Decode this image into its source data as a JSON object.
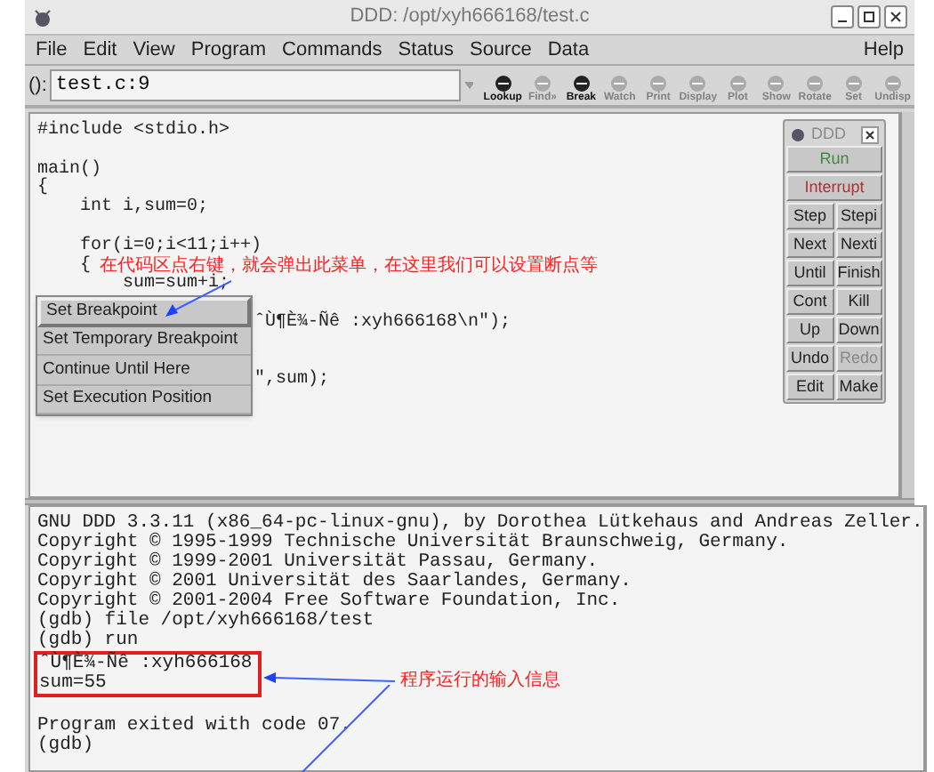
{
  "window": {
    "title": "DDD: /opt/xyh666168/test.c"
  },
  "menu": [
    {
      "label": "File"
    },
    {
      "label": "Edit"
    },
    {
      "label": "View"
    },
    {
      "label": "Program"
    },
    {
      "label": "Commands"
    },
    {
      "label": "Status"
    },
    {
      "label": "Source"
    },
    {
      "label": "Data"
    }
  ],
  "help_menu": "Help",
  "argument": {
    "label": "():",
    "value": "test.c:9"
  },
  "toolbar": [
    {
      "label": "Lookup",
      "disabled": false
    },
    {
      "label": "Find»",
      "disabled": true
    },
    {
      "label": "Break",
      "disabled": false
    },
    {
      "label": "Watch",
      "disabled": true
    },
    {
      "label": "Print",
      "disabled": true
    },
    {
      "label": "Display",
      "disabled": true
    },
    {
      "label": "Plot",
      "disabled": true
    },
    {
      "label": "Show",
      "disabled": true
    },
    {
      "label": "Rotate",
      "disabled": true
    },
    {
      "label": "Set",
      "disabled": true
    },
    {
      "label": "Undisp",
      "disabled": true
    }
  ],
  "source_lines": [
    {
      "kind": "full",
      "text": "#include <stdio.h>"
    },
    {
      "kind": "blank"
    },
    {
      "kind": "full",
      "text": "main()"
    },
    {
      "kind": "full",
      "text": "{"
    },
    {
      "kind": "full",
      "text": "    int i,sum=0;"
    },
    {
      "kind": "blank"
    },
    {
      "kind": "full",
      "text": "    for(i=0;i<11;i++)"
    },
    {
      "kind": "full",
      "text": "    {"
    },
    {
      "kind": "full",
      "text": "        sum=sum+i;"
    },
    {
      "kind": "blank"
    },
    {
      "kind": "partial",
      "text": "ˆÙ¶È¾-Ñê :xyh666168\\n\");"
    },
    {
      "kind": "blank"
    },
    {
      "kind": "blank"
    },
    {
      "kind": "partial",
      "text": "\",sum);"
    }
  ],
  "context_menu": [
    {
      "label": "Set Breakpoint",
      "selected": true
    },
    {
      "label": "Set Temporary Breakpoint",
      "selected": false
    },
    {
      "label": "Continue Until Here",
      "selected": false
    },
    {
      "label": "Set Execution Position",
      "selected": false
    }
  ],
  "annotations": [
    {
      "text": "在代码区点右键，就会弹出此菜单，在这里我们可以设置断点等"
    },
    {
      "text": "程序运行的输入信息"
    }
  ],
  "command_tool": {
    "title": "DDD",
    "buttons": [
      {
        "label": "Run",
        "kind": "run",
        "disabled": false
      },
      {
        "label": "Interrupt",
        "kind": "interrupt",
        "disabled": false
      },
      {
        "label": "Step",
        "disabled": false
      },
      {
        "label": "Stepi",
        "disabled": false
      },
      {
        "label": "Next",
        "disabled": false
      },
      {
        "label": "Nexti",
        "disabled": false
      },
      {
        "label": "Until",
        "disabled": false
      },
      {
        "label": "Finish",
        "disabled": false
      },
      {
        "label": "Cont",
        "disabled": false
      },
      {
        "label": "Kill",
        "disabled": false
      },
      {
        "label": "Up",
        "disabled": false
      },
      {
        "label": "Down",
        "disabled": false
      },
      {
        "label": "Undo",
        "disabled": false
      },
      {
        "label": "Redo",
        "disabled": true
      },
      {
        "label": "Edit",
        "disabled": false
      },
      {
        "label": "Make",
        "disabled": false
      }
    ]
  },
  "console": {
    "lines": [
      "GNU DDD 3.3.11 (x86_64-pc-linux-gnu), by Dorothea Lütkehaus and Andreas Zeller.",
      "Copyright © 1995-1999 Technische Universität Braunschweig, Germany.",
      "Copyright © 1999-2001 Universität Passau, Germany.",
      "Copyright © 2001 Universität des Saarlandes, Germany.",
      "Copyright © 2001-2004 Free Software Foundation, Inc.",
      "(gdb) file /opt/xyh666168/test",
      "(gdb) run"
    ],
    "output": [
      "ˆÙ¶È¾-Ñê :xyh666168",
      "sum=55"
    ],
    "after": [
      "Program exited with code 07.",
      "(gdb)"
    ]
  }
}
